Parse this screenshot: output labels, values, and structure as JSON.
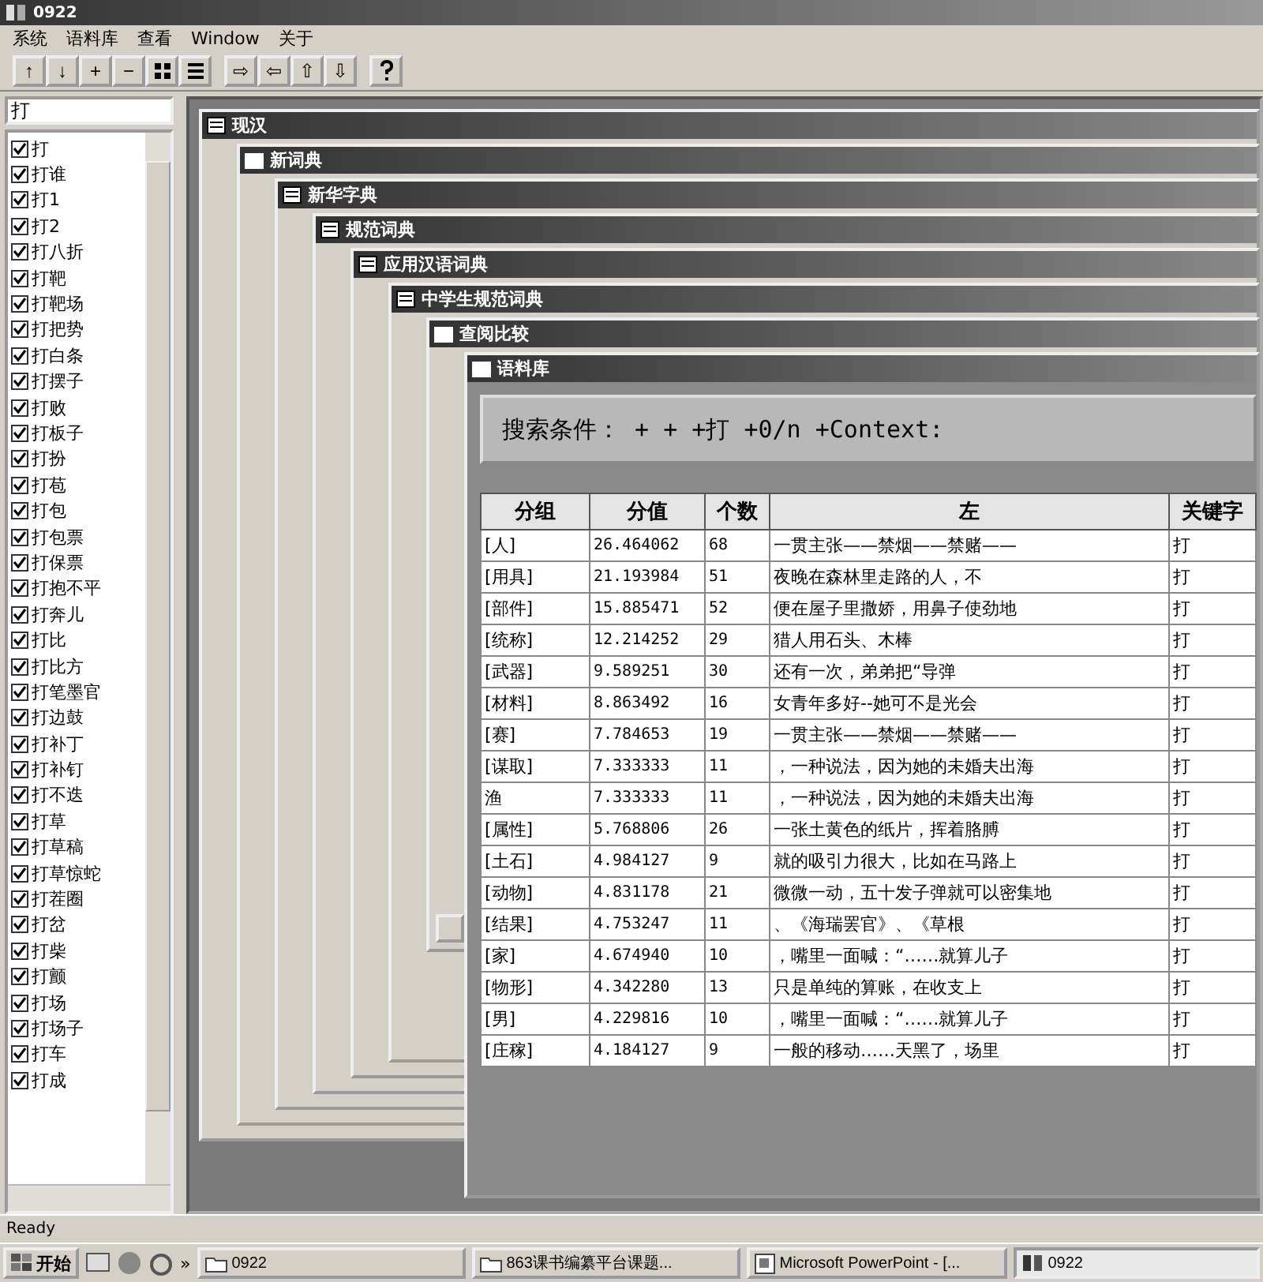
{
  "window": {
    "title": "0922"
  },
  "menu": [
    "系统",
    "语料库",
    "查看",
    "Window",
    "关于"
  ],
  "toolbar": [
    {
      "kind": "text",
      "label": "↑"
    },
    {
      "kind": "text",
      "label": "↓"
    },
    {
      "kind": "text",
      "label": "+"
    },
    {
      "kind": "text",
      "label": "−"
    },
    {
      "kind": "grid"
    },
    {
      "kind": "lines"
    },
    {
      "kind": "gap"
    },
    {
      "kind": "text",
      "label": "⇨"
    },
    {
      "kind": "text",
      "label": "⇦"
    },
    {
      "kind": "text",
      "label": "⇧"
    },
    {
      "kind": "text",
      "label": "⇩"
    },
    {
      "kind": "gap"
    },
    {
      "kind": "help"
    }
  ],
  "sidebar": {
    "search_value": "打",
    "items": [
      {
        "label": "打",
        "checked": true
      },
      {
        "label": "打谁",
        "checked": true
      },
      {
        "label": "打1",
        "checked": true
      },
      {
        "label": "打2",
        "checked": true
      },
      {
        "label": "打八折",
        "checked": true
      },
      {
        "label": "打靶",
        "checked": true
      },
      {
        "label": "打靶场",
        "checked": true
      },
      {
        "label": "打把势",
        "checked": true
      },
      {
        "label": "打白条",
        "checked": true
      },
      {
        "label": "打摆子",
        "checked": true
      },
      {
        "label": "打败",
        "checked": true
      },
      {
        "label": "打板子",
        "checked": true
      },
      {
        "label": "打扮",
        "checked": true
      },
      {
        "label": "打苞",
        "checked": true
      },
      {
        "label": "打包",
        "checked": true
      },
      {
        "label": "打包票",
        "checked": true
      },
      {
        "label": "打保票",
        "checked": true
      },
      {
        "label": "打抱不平",
        "checked": true
      },
      {
        "label": "打奔儿",
        "checked": true
      },
      {
        "label": "打比",
        "checked": true
      },
      {
        "label": "打比方",
        "checked": true
      },
      {
        "label": "打笔墨官",
        "checked": true
      },
      {
        "label": "打边鼓",
        "checked": true
      },
      {
        "label": "打补丁",
        "checked": true
      },
      {
        "label": "打补钉",
        "checked": true
      },
      {
        "label": "打不迭",
        "checked": true
      },
      {
        "label": "打草",
        "checked": true
      },
      {
        "label": "打草稿",
        "checked": true
      },
      {
        "label": "打草惊蛇",
        "checked": true
      },
      {
        "label": "打茬圈",
        "checked": true
      },
      {
        "label": "打岔",
        "checked": true
      },
      {
        "label": "打柴",
        "checked": true
      },
      {
        "label": "打颤",
        "checked": true
      },
      {
        "label": "打场",
        "checked": true
      },
      {
        "label": "打场子",
        "checked": true
      },
      {
        "label": "打车",
        "checked": true
      },
      {
        "label": "打成",
        "checked": true
      }
    ]
  },
  "mdi_windows": [
    {
      "title": "现汉",
      "kind": "document"
    },
    {
      "title": "新词典",
      "kind": "plain"
    },
    {
      "title": "新华字典",
      "kind": "document"
    },
    {
      "title": "规范词典",
      "kind": "document"
    },
    {
      "title": "应用汉语词典",
      "kind": "document"
    },
    {
      "title": "中学生规范词典",
      "kind": "document"
    },
    {
      "title": "查阅比较",
      "kind": "plain"
    }
  ],
  "corpus_window": {
    "title": "语料库",
    "search_condition": "搜索条件： + + +打 +0/n +Context:",
    "table": {
      "columns": [
        "分组",
        "分值",
        "个数",
        "左",
        "关键字"
      ],
      "rows": [
        [
          "[人]",
          "26.464062",
          "68",
          "一贯主张——禁烟——禁赌——",
          "打"
        ],
        [
          "[用具]",
          "21.193984",
          "51",
          "夜晚在森林里走路的人，不",
          "打"
        ],
        [
          "[部件]",
          "15.885471",
          "52",
          "便在屋子里撒娇，用鼻子使劲地",
          "打"
        ],
        [
          "[统称]",
          "12.214252",
          "29",
          "猎人用石头、木棒",
          "打"
        ],
        [
          "[武器]",
          "9.589251",
          "30",
          "还有一次，弟弟把“导弹",
          "打"
        ],
        [
          "[材料]",
          "8.863492",
          "16",
          "女青年多好--她可不是光会",
          "打"
        ],
        [
          "[赛]",
          "7.784653",
          "19",
          "一贯主张——禁烟——禁赌——",
          "打"
        ],
        [
          "[谋取]",
          "7.333333",
          "11",
          "，一种说法，因为她的未婚夫出海",
          "打"
        ],
        [
          "渔",
          "7.333333",
          "11",
          "，一种说法，因为她的未婚夫出海",
          "打"
        ],
        [
          "[属性]",
          "5.768806",
          "26",
          "一张土黄色的纸片，挥着胳膊",
          "打"
        ],
        [
          "[土石]",
          "4.984127",
          "9",
          "就的吸引力很大，比如在马路上",
          "打"
        ],
        [
          "[动物]",
          "4.831178",
          "21",
          "微微一动，五十发子弹就可以密集地",
          "打"
        ],
        [
          "[结果]",
          "4.753247",
          "11",
          "、《海瑞罢官》、《草根",
          "打"
        ],
        [
          "[家]",
          "4.674940",
          "10",
          "，嘴里一面喊：“……就算儿子",
          "打"
        ],
        [
          "[物形]",
          "4.342280",
          "13",
          "只是单纯的算账，在收支上",
          "打"
        ],
        [
          "[男]",
          "4.229816",
          "10",
          "，嘴里一面喊：“……就算儿子",
          "打"
        ],
        [
          "[庄稼]",
          "4.184127",
          "9",
          "一般的移动……天黑了，场里",
          "打"
        ]
      ]
    }
  },
  "status_bar": "Ready",
  "taskbar": {
    "start": "开始",
    "more": "»",
    "buttons": [
      {
        "label": "0922",
        "kind": "folder"
      },
      {
        "label": "863课书编纂平台课题...",
        "kind": "folder"
      },
      {
        "label": "Microsoft PowerPoint - [...",
        "kind": "ppt"
      },
      {
        "label": "0922",
        "kind": "app"
      }
    ]
  }
}
